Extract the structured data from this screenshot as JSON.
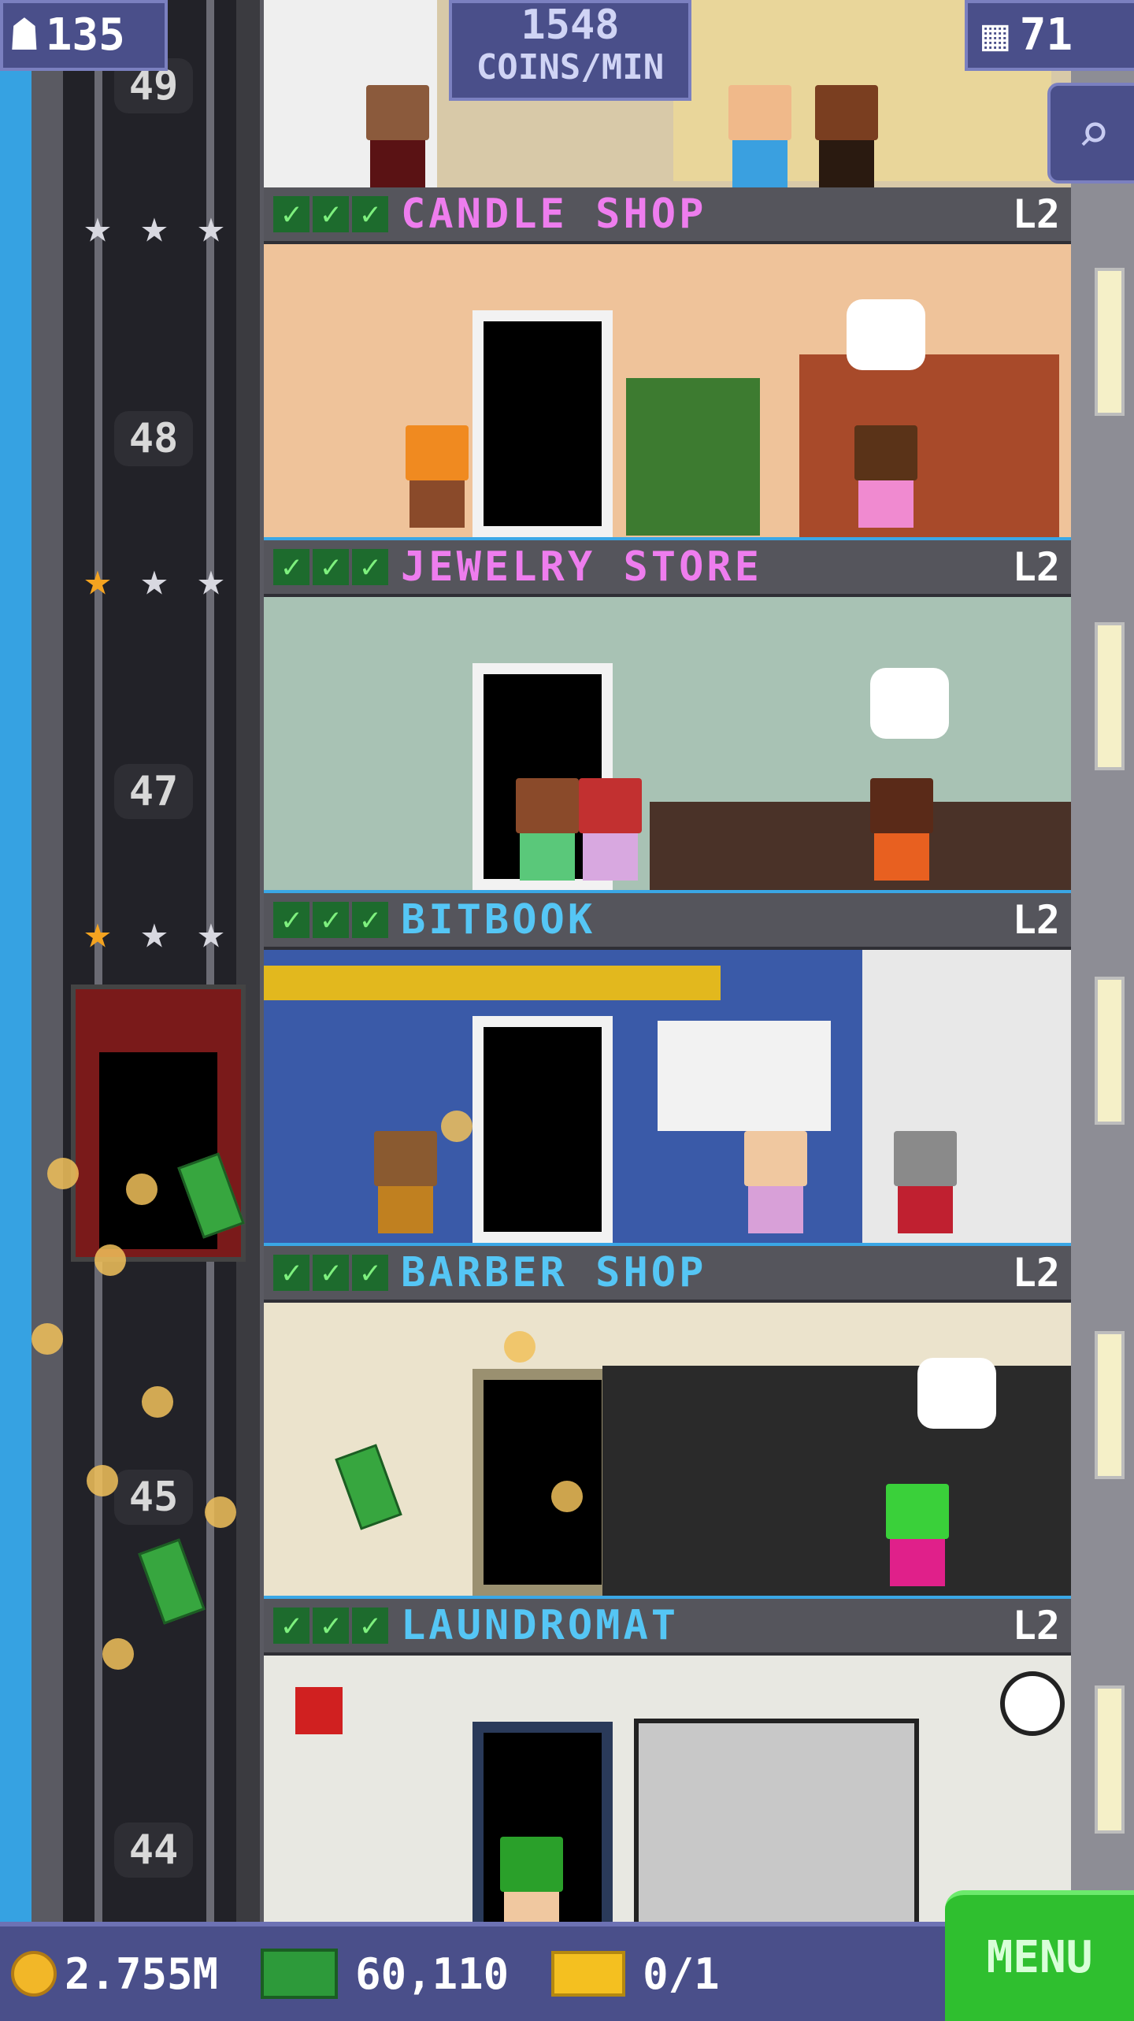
{
  "hud": {
    "population": "135",
    "coins_per_min_value": "1548",
    "coins_per_min_label": "COINS/MIN",
    "floors": "71",
    "search_icon": "magnifier-icon"
  },
  "elevator": {
    "floor_numbers": [
      "49",
      "48",
      "47",
      "45",
      "44"
    ]
  },
  "floors": [
    {
      "name": "CANDLE SHOP",
      "level": "L2",
      "color": "#ee7dee",
      "stock_stars": 0
    },
    {
      "name": "JEWELRY STORE",
      "level": "L2",
      "color": "#ee7dee",
      "stock_stars": 1
    },
    {
      "name": "BITBOOK",
      "level": "L2",
      "color": "#55c6f5",
      "stock_stars": 1
    },
    {
      "name": "BARBER SHOP",
      "level": "L2",
      "color": "#55c6f5",
      "stock_stars": 0
    },
    {
      "name": "LAUNDROMAT",
      "level": "L2",
      "color": "#55c6f5",
      "stock_stars": 0
    }
  ],
  "bottom": {
    "coins": "2.755M",
    "bux": "60,110",
    "tickets": "0/1",
    "menu_label": "MENU"
  },
  "colors": {
    "hud_bg": "#4a4f8a",
    "menu_green": "#2fbf2f",
    "pink_label": "#ee7dee",
    "blue_label": "#55c6f5"
  }
}
